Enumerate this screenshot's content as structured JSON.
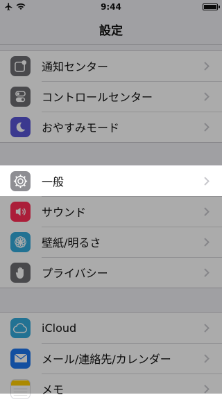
{
  "status": {
    "time": "9:44"
  },
  "nav": {
    "title": "設定"
  },
  "groups": [
    [
      {
        "label": "通知センター",
        "icon": "notification-center-icon",
        "color": "#6d6d72"
      },
      {
        "label": "コントロールセンター",
        "icon": "control-center-icon",
        "color": "#6d6d72"
      },
      {
        "label": "おやすみモード",
        "icon": "do-not-disturb-icon",
        "color": "#5856d6"
      }
    ],
    [
      {
        "label": "一般",
        "icon": "gear-icon",
        "color": "#8e8e93"
      },
      {
        "label": "サウンド",
        "icon": "sound-icon",
        "color": "#ff2d55"
      },
      {
        "label": "壁紙/明るさ",
        "icon": "wallpaper-icon",
        "color": "#34aadc"
      },
      {
        "label": "プライバシー",
        "icon": "privacy-hand-icon",
        "color": "#6d6d72"
      }
    ],
    [
      {
        "label": "iCloud",
        "icon": "icloud-icon",
        "color": "#34aadc"
      },
      {
        "label": "メール/連絡先/カレンダー",
        "icon": "mail-icon",
        "color": "#1d77ef"
      },
      {
        "label": "メモ",
        "icon": "notes-icon",
        "color": "#ffcc00"
      }
    ]
  ]
}
